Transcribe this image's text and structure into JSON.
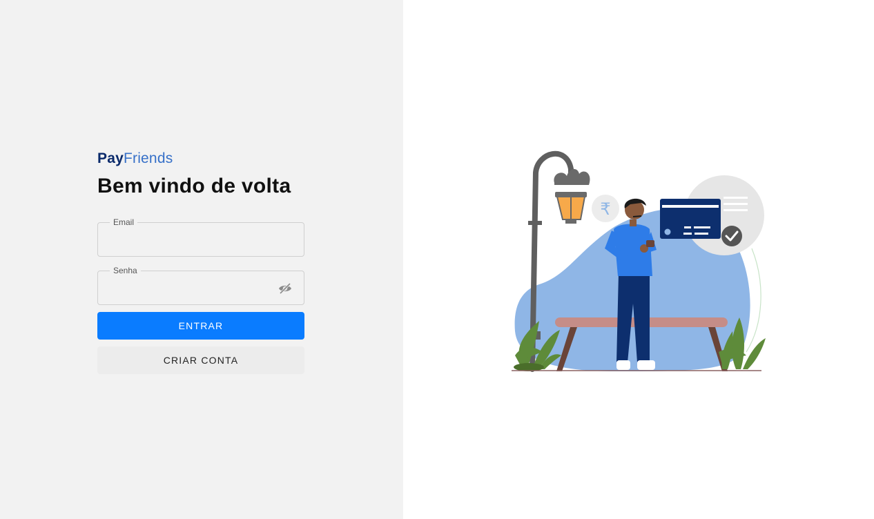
{
  "brand": {
    "part1": "Pay",
    "part2": "Friends"
  },
  "login": {
    "title": "Bem vindo de volta",
    "email": {
      "label": "Email",
      "value": ""
    },
    "password": {
      "label": "Senha",
      "value": "",
      "toggle_icon": "eye-off-icon"
    },
    "submit_label": "ENTRAR",
    "create_account_label": "CRIAR CONTA"
  },
  "illustration": {
    "currency_symbol": "₹",
    "icon": "check-icon"
  },
  "colors": {
    "left_bg": "#f2f2f2",
    "primary": "#0a7cff",
    "secondary_btn": "#ececec",
    "brand_dark": "#0a2a6b",
    "brand_light": "#3670c8"
  }
}
